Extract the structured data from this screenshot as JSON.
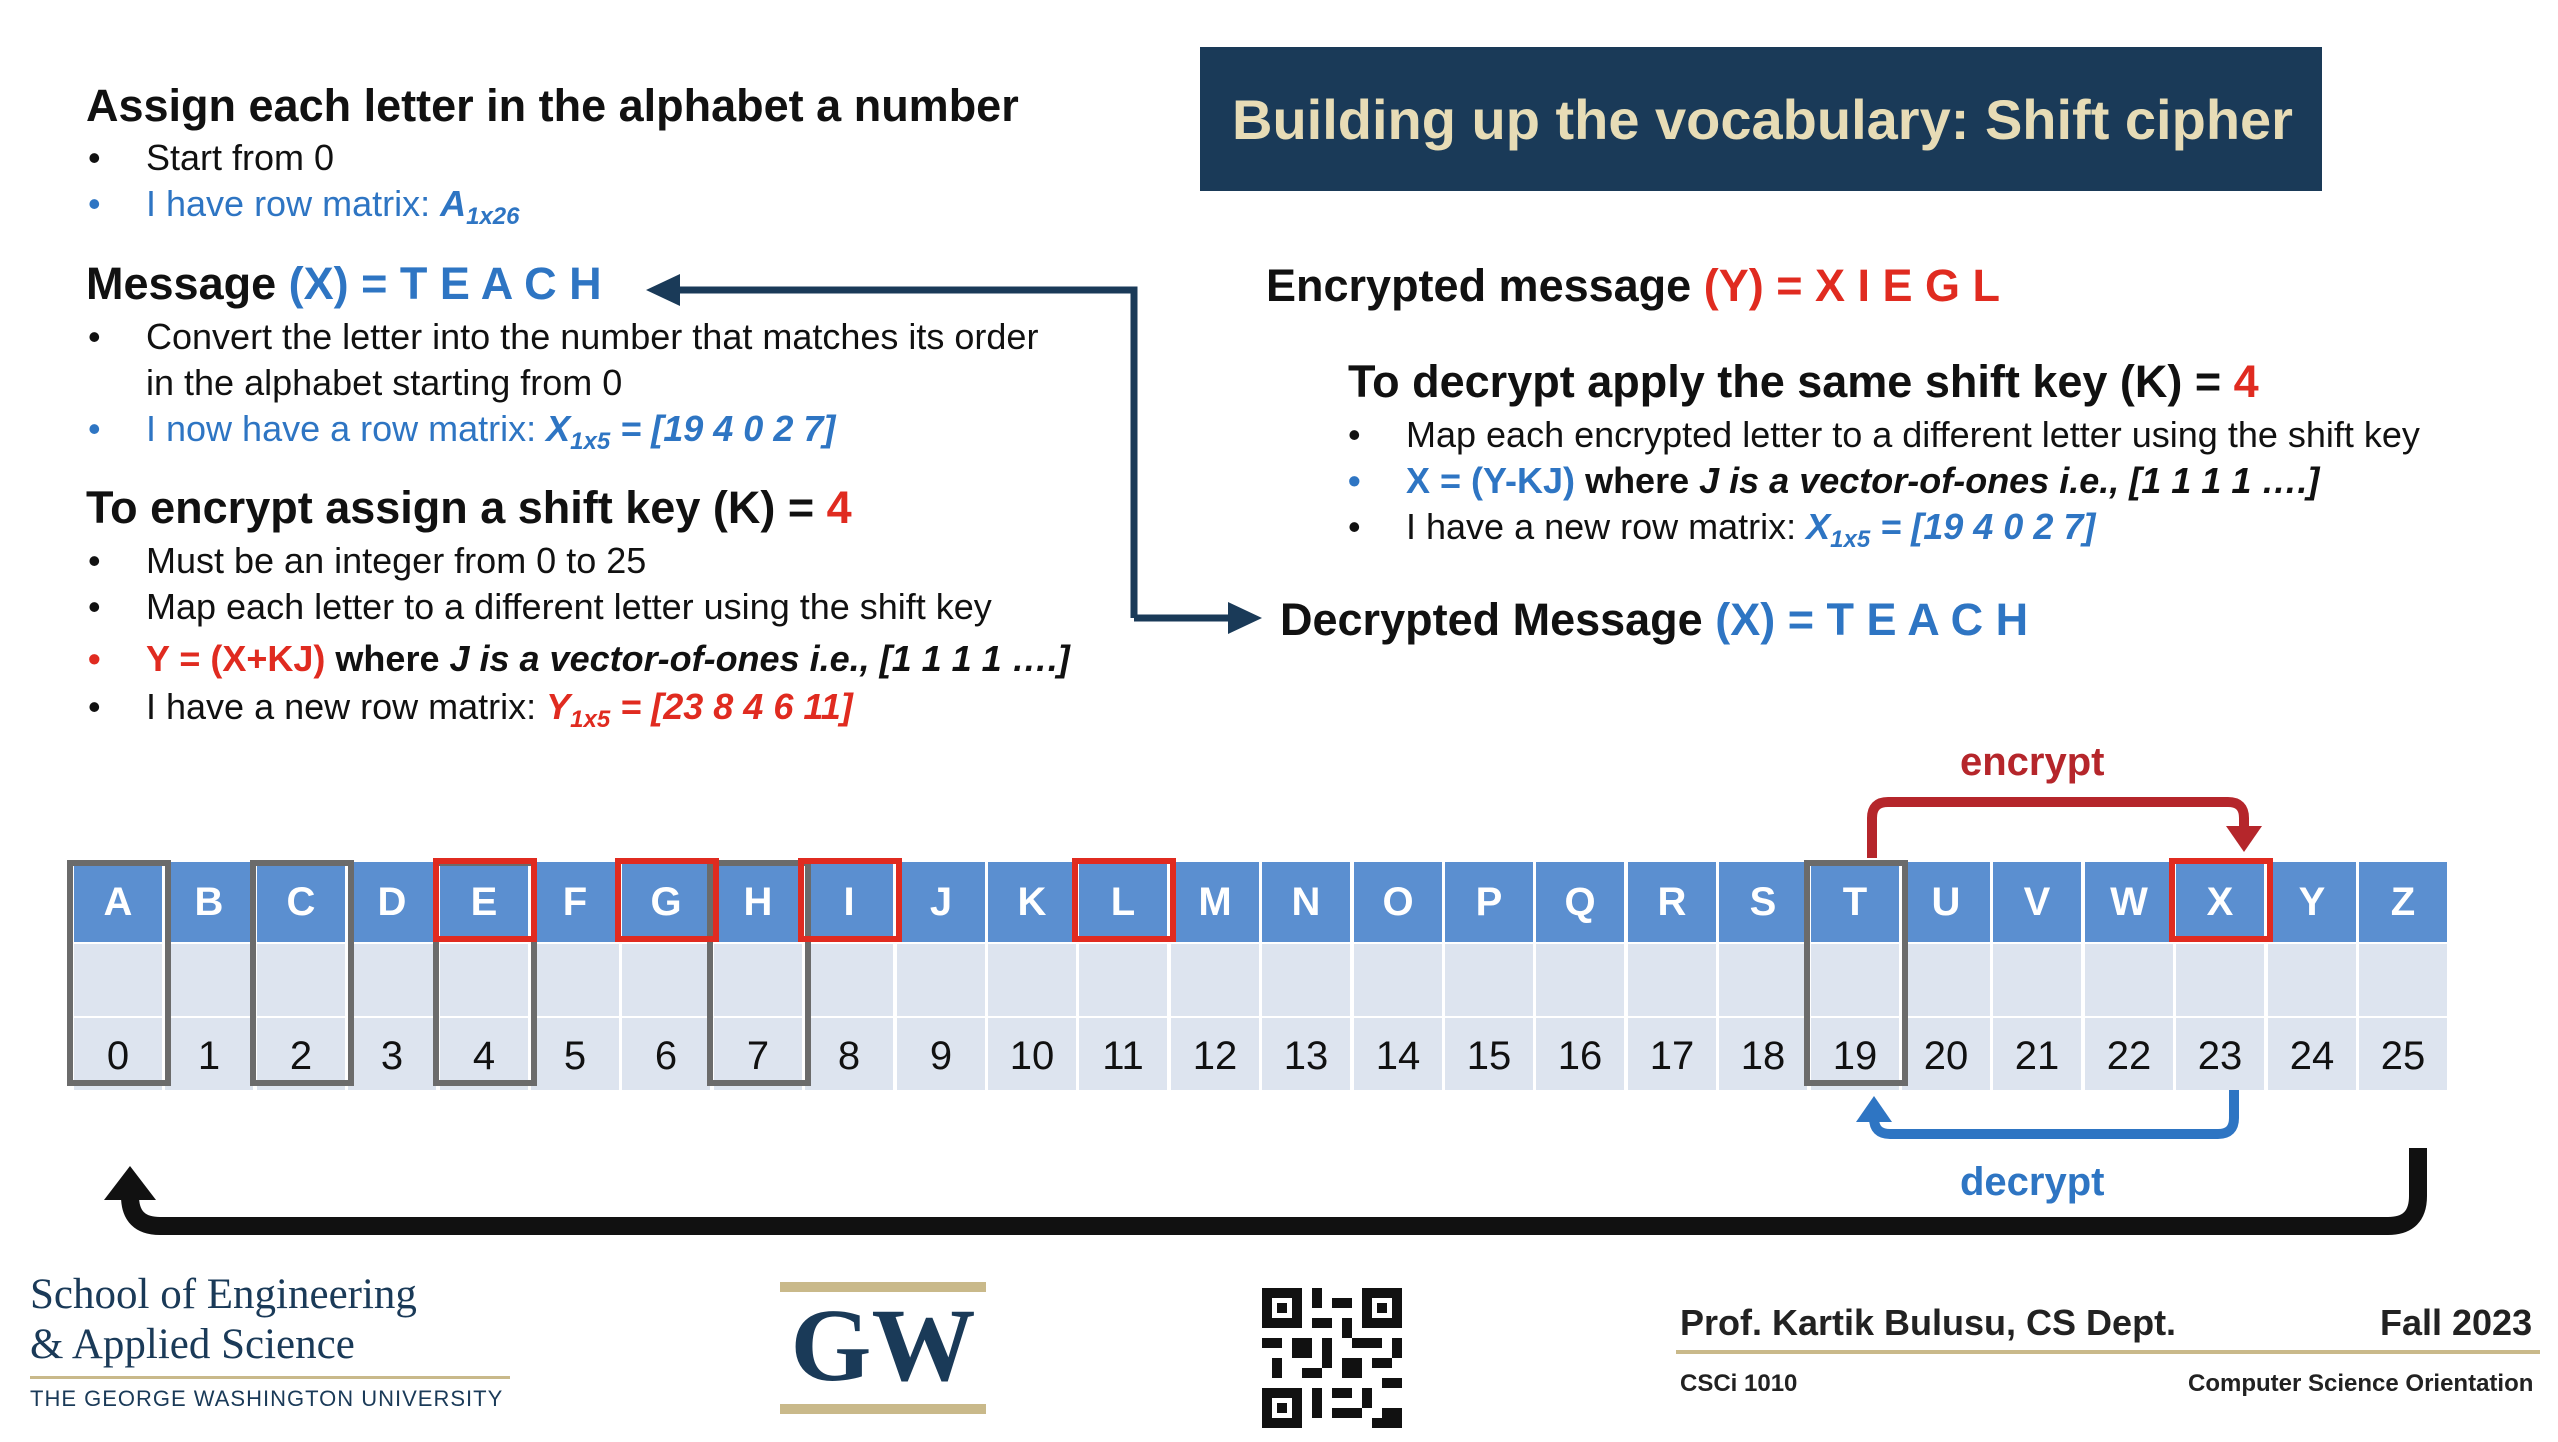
{
  "title": "Building up the vocabulary: Shift cipher",
  "left": {
    "s1": {
      "heading": "Assign each letter in the alphabet a number",
      "b1": "Start from 0",
      "b2_pre": "I have row matrix: ",
      "b2_var": "A",
      "b2_sub": "1x26"
    },
    "s2": {
      "h_pre": "Message ",
      "h_x": "(X)",
      "h_eq": " = T E A C H",
      "b1_line1": "Convert the letter into the number that matches its order",
      "b1_line2": "in the alphabet starting from 0",
      "b2_pre": "I now have a row matrix: ",
      "b2_var": "X",
      "b2_sub": "1x5",
      "b2_val": " = [19 4 0 2 7]"
    },
    "s3": {
      "h_pre": "To encrypt assign a shift key (K) = ",
      "h_k": "4",
      "b1": "Must be an integer from 0 to 25",
      "b2": "Map each letter to a different letter using the shift key",
      "b3_formula": "Y = (X+KJ)",
      "b3_where": " where ",
      "b3_rest": "J is a vector-of-ones i.e., [1 1 1 1 ….]",
      "b4_pre": "I have a new row matrix: ",
      "b4_var": "Y",
      "b4_sub": "1x5",
      "b4_val": " = [23 8 4 6 11]"
    }
  },
  "right": {
    "enc": {
      "pre": "Encrypted message ",
      "y": "(Y) = X I E G L"
    },
    "dec": {
      "h_pre": "To decrypt apply the same shift key (K) = ",
      "h_k": "4",
      "b1": "Map each encrypted letter to a different letter using the shift key",
      "b2_formula": "X = (Y-KJ)",
      "b2_where": " where ",
      "b2_rest": "J is a vector-of-ones i.e., [1 1 1 1 ….]",
      "b3_pre": "I have a new row matrix: ",
      "b3_var": "X",
      "b3_sub": "1x5",
      "b3_val": " = [19 4 0 2 7]"
    },
    "decrypted": {
      "pre": "Decrypted Message ",
      "x": "(X) = T E A C H"
    }
  },
  "labels": {
    "encrypt": "encrypt",
    "decrypt": "decrypt"
  },
  "bullet": "•",
  "letters": [
    "A",
    "B",
    "C",
    "D",
    "E",
    "F",
    "G",
    "H",
    "I",
    "J",
    "K",
    "L",
    "M",
    "N",
    "O",
    "P",
    "Q",
    "R",
    "S",
    "T",
    "U",
    "V",
    "W",
    "X",
    "Y",
    "Z"
  ],
  "numbers": [
    "0",
    "1",
    "2",
    "3",
    "4",
    "5",
    "6",
    "7",
    "8",
    "9",
    "10",
    "11",
    "12",
    "13",
    "14",
    "15",
    "16",
    "17",
    "18",
    "19",
    "20",
    "21",
    "22",
    "23",
    "24",
    "25"
  ],
  "gray_highlight": [
    "A",
    "C",
    "E",
    "H",
    "T"
  ],
  "red_highlight": [
    "E",
    "G",
    "I",
    "L",
    "X"
  ],
  "footer": {
    "school_line1": "School of Engineering",
    "school_line2": "& Applied Science",
    "university": "THE GEORGE WASHINGTON UNIVERSITY",
    "gw_logo": "GW",
    "professor": "Prof. Kartik Bulusu, CS Dept.",
    "term": "Fall 2023",
    "course": "CSCi 1010",
    "course_name": "Computer Science Orientation"
  },
  "colors": {
    "navy": "#1a3a58",
    "title_text": "#e7dcb6",
    "blue": "#2e75c3",
    "red": "#e02b20",
    "cell_blue": "#5b8fd0",
    "cell_light": "#dde4ef",
    "gray_box": "#6b6b6b"
  }
}
